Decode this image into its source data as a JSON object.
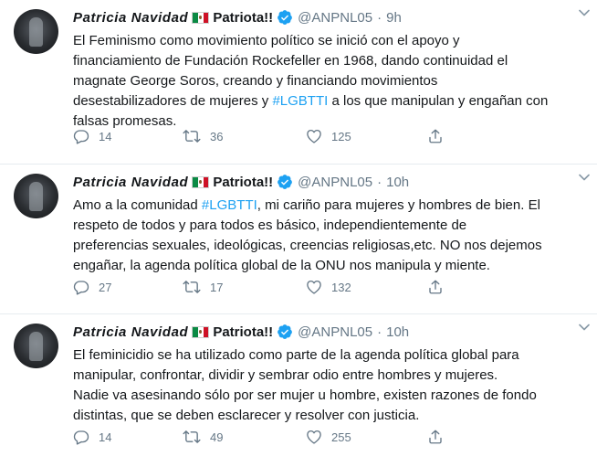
{
  "tweets": [
    {
      "name": "Patricia Navidad",
      "name_suffix": "Patriota!!",
      "handle": "@ANPNL05",
      "separator": "·",
      "time": "9h",
      "text_before": "El Feminismo como movimiento político se inició con el apoyo y\nfinanciamiento de Fundación Rockefeller en 1968, dando continuidad el\nmagnate George Soros, creando y financiando movimientos\ndesestabilizadores de mujeres y ",
      "hashtag": "#LGBTTI",
      "text_after": " a los que manipulan y engañan con\nfalsas promesas.",
      "replies": "14",
      "retweets": "36",
      "likes": "125"
    },
    {
      "name": "Patricia Navidad",
      "name_suffix": "Patriota!!",
      "handle": "@ANPNL05",
      "separator": "·",
      "time": "10h",
      "text_before": "Amo a la comunidad ",
      "hashtag": "#LGBTTI",
      "text_after": ", mi cariño para mujeres y hombres de bien. El\nrespeto de todos y para todos es básico, independientemente de\npreferencias sexuales, ideológicas, creencias religiosas,etc. NO nos dejemos\nengañar, la agenda política global de la ONU nos manipula y miente.",
      "replies": "27",
      "retweets": "17",
      "likes": "132"
    },
    {
      "name": "Patricia Navidad",
      "name_suffix": "Patriota!!",
      "handle": "@ANPNL05",
      "separator": "·",
      "time": "10h",
      "text": "El feminicidio se ha utilizado como parte de la agenda política global para\nmanipular, confrontar, dividir y sembrar odio entre hombres y mujeres.\nNadie va asesinando sólo por ser mujer u hombre, existen razones de fondo\ndistintas, que se deben esclarecer y resolver con justicia.",
      "replies": "14",
      "retweets": "49",
      "likes": "255"
    }
  ],
  "colors": {
    "accent": "#1da1f2",
    "secondary_text": "#657786",
    "divider": "#e6ecf0"
  },
  "icons": [
    "mexico-flag-icon",
    "verified-badge-icon",
    "chevron-down-icon",
    "reply-icon",
    "retweet-icon",
    "like-icon",
    "share-icon"
  ]
}
